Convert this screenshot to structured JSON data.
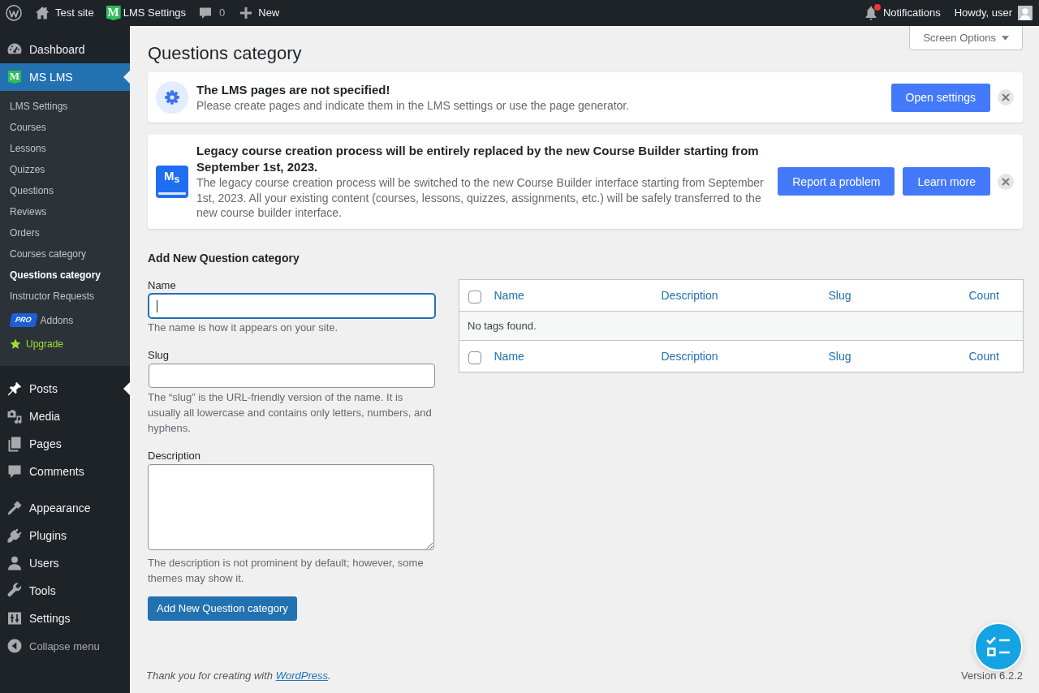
{
  "admin_bar": {
    "site_name": "Test site",
    "plugin": {
      "logo": "M",
      "label": "LMS Settings"
    },
    "comments_count": "0",
    "new_label": "New",
    "notifications": {
      "label": "Notifications",
      "unread": true
    },
    "greeting": "Howdy, user"
  },
  "sidebar": {
    "sections": [
      {
        "items": [
          {
            "label": "Dashboard",
            "selected": false,
            "hovered": false
          },
          {
            "label": "MS LMS",
            "logo": "M",
            "selected": true,
            "hovered": false,
            "submenu": [
              {
                "kind": "link",
                "label": "LMS Settings",
                "selected": false
              },
              {
                "kind": "link",
                "label": "Courses",
                "selected": false
              },
              {
                "kind": "link",
                "label": "Lessons",
                "selected": false
              },
              {
                "kind": "link",
                "label": "Quizzes",
                "selected": false
              },
              {
                "kind": "link",
                "label": "Questions",
                "selected": false
              },
              {
                "kind": "link",
                "label": "Reviews",
                "selected": false
              },
              {
                "kind": "link",
                "label": "Orders",
                "selected": false
              },
              {
                "kind": "link",
                "label": "Courses category",
                "selected": false
              },
              {
                "kind": "link",
                "label": "Questions category",
                "selected": true
              },
              {
                "kind": "link",
                "label": "Instructor Requests",
                "selected": false
              },
              {
                "kind": "pro",
                "badge": "PRO",
                "label": "Addons",
                "selected": false
              },
              {
                "kind": "upgrade",
                "label": "Upgrade",
                "selected": false
              }
            ]
          }
        ]
      },
      {
        "items": [
          {
            "label": "Posts",
            "selected": false,
            "hovered": true
          },
          {
            "label": "Media",
            "selected": false,
            "hovered": false
          },
          {
            "label": "Pages",
            "selected": false,
            "hovered": false
          },
          {
            "label": "Comments",
            "selected": false,
            "hovered": false
          }
        ]
      },
      {
        "items": [
          {
            "label": "Appearance",
            "selected": false,
            "hovered": false
          },
          {
            "label": "Plugins",
            "selected": false,
            "hovered": false
          },
          {
            "label": "Users",
            "selected": false,
            "hovered": false
          },
          {
            "label": "Tools",
            "selected": false,
            "hovered": false
          },
          {
            "label": "Settings",
            "selected": false,
            "hovered": false
          }
        ]
      }
    ],
    "collapse_label": "Collapse menu"
  },
  "page": {
    "title": "Questions category",
    "screen_options": "Screen Options"
  },
  "notices": [
    {
      "kind": "settings",
      "title": "The LMS pages are not specified!",
      "text": "Please create pages and indicate them in the LMS settings or use the page generator.",
      "actions": [
        "Open settings"
      ],
      "dismissible": true
    },
    {
      "kind": "course-builder",
      "logo": "M$_{s}$",
      "title": "Legacy course creation process will be entirely replaced by the new Course Builder starting from September 1st, 2023.",
      "text": "The legacy course creation process will be switched to the new Course Builder interface starting from September 1st, 2023. All your existing content (courses, lessons, quizzes, assignments, etc.) will be safely transferred to the new course builder interface.",
      "actions": [
        "Report a problem",
        "Learn more"
      ],
      "dismissible": true
    }
  ],
  "form": {
    "heading": "Add New Question category",
    "fields": [
      {
        "kind": "input",
        "label": "Name",
        "focused": true,
        "help": "The name is how it appears on your site."
      },
      {
        "kind": "input",
        "label": "Slug",
        "focused": false,
        "help": "The “slug” is the URL-friendly version of the name. It is usually all lowercase and contains only letters, numbers, and hyphens."
      },
      {
        "kind": "textarea",
        "label": "Description",
        "focused": false,
        "help": "The description is not prominent by default; however, some themes may show it."
      }
    ],
    "submit_label": "Add New Question category"
  },
  "table": {
    "header": {
      "checked": false,
      "columns": [
        "Name",
        "Description",
        "Slug",
        "Count"
      ]
    },
    "empty_message": "No tags found.",
    "footer": {
      "checked": false,
      "columns": [
        "Name",
        "Description",
        "Slug",
        "Count"
      ]
    }
  },
  "footer": {
    "credit": {
      "prefix": "Thank you for creating with",
      "link": "WordPress",
      "suffix": "."
    },
    "version": "Version 6.2.2"
  }
}
